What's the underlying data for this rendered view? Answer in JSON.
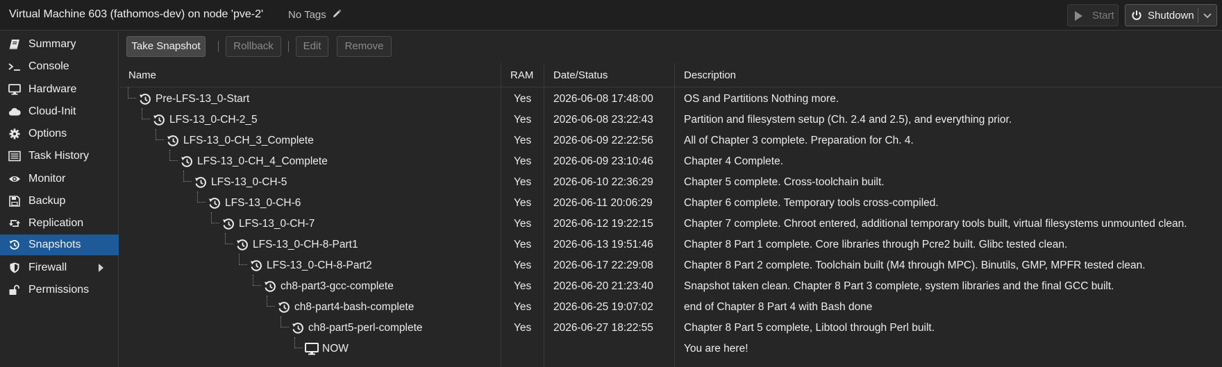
{
  "header": {
    "title": "Virtual Machine 603 (fathomos-dev) on node 'pve-2'",
    "tags": "No Tags",
    "start_label": "Start",
    "shutdown_label": "Shutdown"
  },
  "sidebar": {
    "items": [
      {
        "label": "Summary",
        "icon": "book-icon"
      },
      {
        "label": "Console",
        "icon": "terminal-icon"
      },
      {
        "label": "Hardware",
        "icon": "monitor-icon"
      },
      {
        "label": "Cloud-Init",
        "icon": "cloud-icon"
      },
      {
        "label": "Options",
        "icon": "gear-icon"
      },
      {
        "label": "Task History",
        "icon": "list-icon"
      },
      {
        "label": "Monitor",
        "icon": "eye-icon"
      },
      {
        "label": "Backup",
        "icon": "floppy-icon"
      },
      {
        "label": "Replication",
        "icon": "retweet-icon"
      },
      {
        "label": "Snapshots",
        "icon": "history-icon",
        "active": true
      },
      {
        "label": "Firewall",
        "icon": "shield-icon"
      },
      {
        "label": "Permissions",
        "icon": "unlock-icon"
      }
    ]
  },
  "toolbar": {
    "take_snapshot": "Take Snapshot",
    "rollback": "Rollback",
    "edit": "Edit",
    "remove": "Remove"
  },
  "table": {
    "columns": {
      "name": "Name",
      "ram": "RAM",
      "date": "Date/Status",
      "description": "Description"
    },
    "rows": [
      {
        "name": "Pre-LFS-13_0-Start",
        "ram": "Yes",
        "date": "2026-06-08 17:48:00",
        "description": "OS and Partitions Nothing more."
      },
      {
        "name": "LFS-13_0-CH-2_5",
        "ram": "Yes",
        "date": "2026-06-08 23:22:43",
        "description": "Partition and filesystem setup (Ch. 2.4 and 2.5), and everything prior."
      },
      {
        "name": "LFS-13_0-CH_3_Complete",
        "ram": "Yes",
        "date": "2026-06-09 22:22:56",
        "description": "All of Chapter 3 complete. Preparation for Ch. 4."
      },
      {
        "name": "LFS-13_0-CH_4_Complete",
        "ram": "Yes",
        "date": "2026-06-09 23:10:46",
        "description": "Chapter 4 Complete."
      },
      {
        "name": "LFS-13_0-CH-5",
        "ram": "Yes",
        "date": "2026-06-10 22:36:29",
        "description": "Chapter 5 complete. Cross-toolchain built."
      },
      {
        "name": "LFS-13_0-CH-6",
        "ram": "Yes",
        "date": "2026-06-11 20:06:29",
        "description": "Chapter 6 complete. Temporary tools cross-compiled."
      },
      {
        "name": "LFS-13_0-CH-7",
        "ram": "Yes",
        "date": "2026-06-12 19:22:15",
        "description": "Chapter 7 complete. Chroot entered, additional temporary tools built, virtual filesystems unmounted clean."
      },
      {
        "name": "LFS-13_0-CH-8-Part1",
        "ram": "Yes",
        "date": "2026-06-13 19:51:46",
        "description": "Chapter 8 Part 1 complete. Core libraries through Pcre2 built. Glibc tested clean."
      },
      {
        "name": "LFS-13_0-CH-8-Part2",
        "ram": "Yes",
        "date": "2026-06-17 22:29:08",
        "description": "Chapter 8 Part 2 complete. Toolchain built (M4 through MPC). Binutils, GMP, MPFR tested clean."
      },
      {
        "name": "ch8-part3-gcc-complete",
        "ram": "Yes",
        "date": "2026-06-20 21:23:40",
        "description": "Snapshot taken clean. Chapter 8 Part 3 complete, system libraries and the final GCC built."
      },
      {
        "name": "ch8-part4-bash-complete",
        "ram": "Yes",
        "date": "2026-06-25 19:07:02",
        "description": "end of Chapter 8 Part 4 with Bash done"
      },
      {
        "name": "ch8-part5-perl-complete",
        "ram": "Yes",
        "date": "2026-06-27 18:22:55",
        "description": "Chapter 8 Part 5 complete, Libtool through Perl built."
      },
      {
        "name": "NOW",
        "ram": "",
        "date": "",
        "description": "You are here!",
        "current": true
      }
    ]
  }
}
